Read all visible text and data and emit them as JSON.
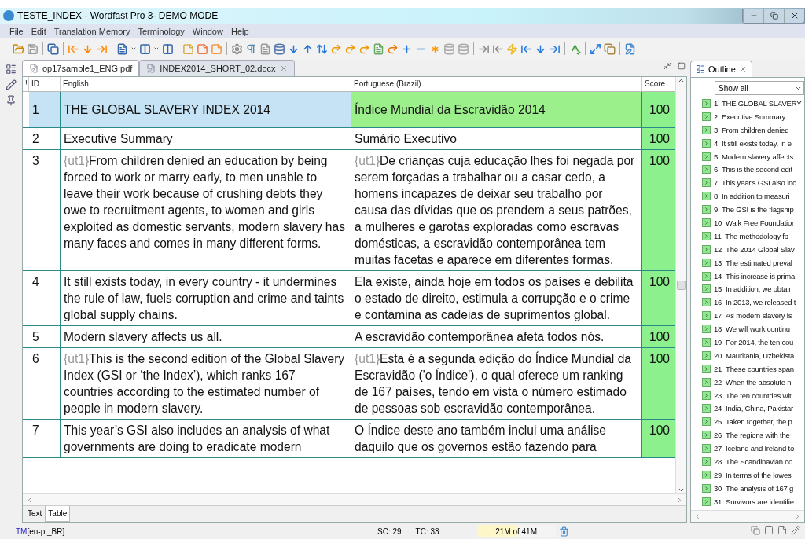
{
  "window": {
    "title": "TESTE_INDEX - Wordfast Pro 3- DEMO MODE"
  },
  "menu": [
    "File",
    "Edit",
    "Translation Memory",
    "Terminology",
    "Window",
    "Help"
  ],
  "editor_tabs": [
    {
      "label": "op17sample1_ENG.pdf",
      "selected": false
    },
    {
      "label": "INDEX2014_SHORT_02.docx",
      "selected": true
    }
  ],
  "table": {
    "columns": [
      "!",
      "ID",
      "English",
      "Portuguese (Brazil)",
      "Score"
    ],
    "rows": [
      {
        "id": "1",
        "selected": true,
        "source": {
          "text": "THE GLOBAL SLAVERY INDEX 2014"
        },
        "target": {
          "text": "Índice Mundial da Escravidão 2014"
        },
        "score": "100"
      },
      {
        "id": "2",
        "selected": false,
        "source": {
          "text": "Executive Summary"
        },
        "target": {
          "text": "Sumário Executivo"
        },
        "score": "100"
      },
      {
        "id": "3",
        "selected": false,
        "source": {
          "tag": "{ut1}",
          "text": "From children denied an education by being forced to work or marry early, to men unable to leave their work because of crushing debts they owe to recruitment agents, to women and girls exploited as domestic servants, modern slavery has many faces and comes in many different forms."
        },
        "target": {
          "tag": "{ut1}",
          "text": "De crianças cuja educação lhes foi negada por serem forçadas a trabalhar ou a casar cedo, a homens incapazes de deixar seu trabalho por causa das dívidas que os prendem a seus patrões, a mulheres e garotas exploradas como escravas domésticas, a escravidão contemporânea tem muitas facetas e aparece em diferentes formas."
        },
        "score": "100"
      },
      {
        "id": "4",
        "selected": false,
        "source": {
          "text": "It still exists today, in every country - it undermines the rule of law, fuels corruption and crime and taints global supply chains."
        },
        "target": {
          "text": "Ela existe, ainda hoje em todos os países e debilita o estado de direito, estimula a corrupção e o crime e contamina as cadeias de suprimentos global."
        },
        "score": "100"
      },
      {
        "id": "5",
        "selected": false,
        "source": {
          "text": "Modern slavery affects us all."
        },
        "target": {
          "text": "A escravidão contemporânea afeta todos nós."
        },
        "score": "100"
      },
      {
        "id": "6",
        "selected": false,
        "source": {
          "tag": "{ut1}",
          "text": "This is the second edition of the Global Slavery Index (GSI or ‘the Index’), which ranks 167 countries according to the estimated number of people in modern slavery."
        },
        "target": {
          "tag": "{ut1}",
          "text": "Esta é a segunda edição do Índice Mundial da Escravidão ('o Índice'), o qual oferece um ranking de 167 países, tendo em vista o número estimado de pessoas sob escravidão contemporânea."
        },
        "score": "100"
      },
      {
        "id": "7",
        "selected": false,
        "source": {
          "text": "This year’s GSI also includes an analysis of what governments are doing to eradicate modern"
        },
        "target": {
          "text": "O Índice deste ano também inclui uma análise daquilo que os governos estão fazendo para"
        },
        "score": "100"
      }
    ]
  },
  "view_tabs": [
    {
      "label": "Text",
      "selected": false
    },
    {
      "label": "Table",
      "selected": true
    }
  ],
  "outline": {
    "title": "Outline",
    "filter": "Show all",
    "items": [
      {
        "num": "1",
        "text": "THE GLOBAL SLAVERY"
      },
      {
        "num": "2",
        "text": "Executive Summary"
      },
      {
        "num": "3",
        "text": "From children denied"
      },
      {
        "num": "4",
        "text": "It still exists today, in e"
      },
      {
        "num": "5",
        "text": "Modern slavery affects"
      },
      {
        "num": "6",
        "text": "This is the second edit"
      },
      {
        "num": "7",
        "text": "This year's GSI also inc"
      },
      {
        "num": "8",
        "text": "In addition to measuri"
      },
      {
        "num": "9",
        "text": "The GSI is the flagship"
      },
      {
        "num": "10",
        "text": "Walk Free Foundatior"
      },
      {
        "num": "11",
        "text": "The methodology fo"
      },
      {
        "num": "12",
        "text": "The 2014 Global Slav"
      },
      {
        "num": "13",
        "text": "The estimated preval"
      },
      {
        "num": "14",
        "text": "This increase is prima"
      },
      {
        "num": "15",
        "text": "In addition, we obtair"
      },
      {
        "num": "16",
        "text": "In 2013, we released t"
      },
      {
        "num": "17",
        "text": "As modern slavery is"
      },
      {
        "num": "18",
        "text": "We will work continu"
      },
      {
        "num": "19",
        "text": "For 2014, the ten cou"
      },
      {
        "num": "20",
        "text": "Mauritania, Uzbekista"
      },
      {
        "num": "21",
        "text": "These countries span"
      },
      {
        "num": "22",
        "text": "When the absolute n"
      },
      {
        "num": "23",
        "text": "The ten countries wit"
      },
      {
        "num": "24",
        "text": "India, China, Pakistar"
      },
      {
        "num": "25",
        "text": "Taken together, the p"
      },
      {
        "num": "26",
        "text": "The regions with the"
      },
      {
        "num": "27",
        "text": "Iceland and Ireland to"
      },
      {
        "num": "28",
        "text": "The Scandinavian co"
      },
      {
        "num": "29",
        "text": "In terms of the lowes"
      },
      {
        "num": "30",
        "text": "The analysis of 167 g"
      },
      {
        "num": "31",
        "text": "Survivors are identifie"
      }
    ]
  },
  "status_bar": {
    "tm_prefix": "TM",
    "tm_lang": "[en-pt_BR]",
    "sc": "SC:  29",
    "tc": "TC:  33",
    "memory": {
      "text": "21M of 41M",
      "level": 0.51
    }
  }
}
